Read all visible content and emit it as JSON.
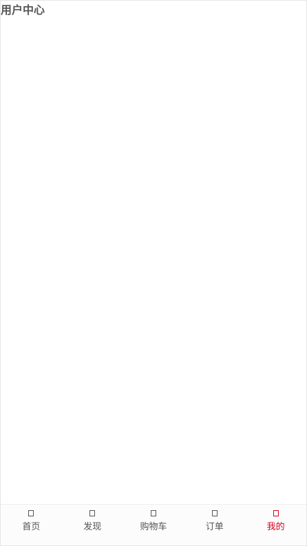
{
  "header": {
    "title": "用户中心"
  },
  "tabbar": {
    "tabs": [
      {
        "label": "首页",
        "icon": "home-icon",
        "active": false
      },
      {
        "label": "发现",
        "icon": "discover-icon",
        "active": false
      },
      {
        "label": "购物车",
        "icon": "cart-icon",
        "active": false
      },
      {
        "label": "订单",
        "icon": "orders-icon",
        "active": false
      },
      {
        "label": "我的",
        "icon": "profile-icon",
        "active": true
      }
    ]
  },
  "colors": {
    "accent": "#d9001b",
    "text": "#555555",
    "border": "#e6e6e6"
  }
}
